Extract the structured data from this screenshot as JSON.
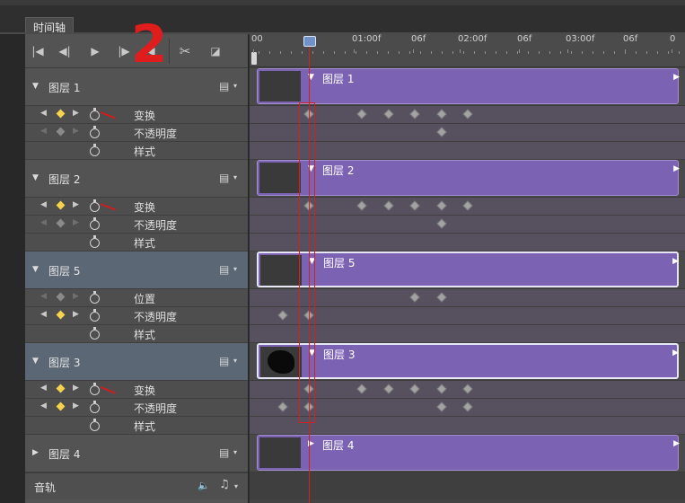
{
  "tab": {
    "label": "时间轴"
  },
  "toolbar": {
    "annotation": "2",
    "buttons": [
      "go-to-first-frame-icon",
      "previous-frame-icon",
      "play-icon",
      "next-frame-icon",
      "split-clip-icon",
      "transition-icon"
    ]
  },
  "ruler": {
    "ticks": [
      "00",
      "01:00f",
      "06f",
      "02:00f",
      "06f",
      "03:00f",
      "06f",
      "0"
    ]
  },
  "layers": [
    {
      "name": "图层 1",
      "expanded": true,
      "selected": false,
      "thumb": "hands",
      "props": [
        {
          "label": "变换",
          "key_on": true,
          "annot": true,
          "kf_times": [
            0,
            1,
            1.5,
            2,
            2.5,
            3
          ]
        },
        {
          "label": "不透明度",
          "key_on": false,
          "annot": false,
          "kf_times": [
            2.5
          ]
        },
        {
          "label": "样式",
          "key_on": false,
          "nav": false,
          "annot": false,
          "kf_times": []
        }
      ]
    },
    {
      "name": "图层 2",
      "expanded": true,
      "selected": false,
      "thumb": "transparent",
      "props": [
        {
          "label": "变换",
          "key_on": true,
          "annot": true,
          "kf_times": [
            0,
            1,
            1.5,
            2,
            2.5,
            3
          ]
        },
        {
          "label": "不透明度",
          "key_on": false,
          "annot": false,
          "kf_times": [
            2.5
          ]
        },
        {
          "label": "样式",
          "key_on": false,
          "nav": false,
          "annot": false,
          "kf_times": []
        }
      ]
    },
    {
      "name": "图层 5",
      "expanded": true,
      "selected": true,
      "thumb": "city",
      "props": [
        {
          "label": "位置",
          "key_on": false,
          "annot": false,
          "kf_times": [
            2,
            2.5
          ]
        },
        {
          "label": "不透明度",
          "key_on": true,
          "annot": false,
          "kf_times": [
            -0.5,
            0
          ]
        },
        {
          "label": "样式",
          "key_on": false,
          "nav": false,
          "annot": false,
          "kf_times": []
        }
      ]
    },
    {
      "name": "图层 3",
      "expanded": true,
      "selected": true,
      "thumb": "blob",
      "props": [
        {
          "label": "变换",
          "key_on": true,
          "annot": true,
          "kf_times": [
            0,
            1,
            1.5,
            2,
            2.5,
            3
          ]
        },
        {
          "label": "不透明度",
          "key_on": true,
          "annot": false,
          "kf_times": [
            -0.5,
            0,
            2.5,
            3
          ]
        },
        {
          "label": "样式",
          "key_on": false,
          "nav": false,
          "annot": false,
          "kf_times": []
        }
      ]
    },
    {
      "name": "图层 4",
      "expanded": false,
      "selected": false,
      "thumb": "sky",
      "props": []
    }
  ],
  "audio": {
    "label": "音轨"
  },
  "colors": {
    "clip": "#7c62b2",
    "playhead": "#d52020",
    "key_active": "#f6d34a",
    "selected_row": "#5c6776"
  }
}
